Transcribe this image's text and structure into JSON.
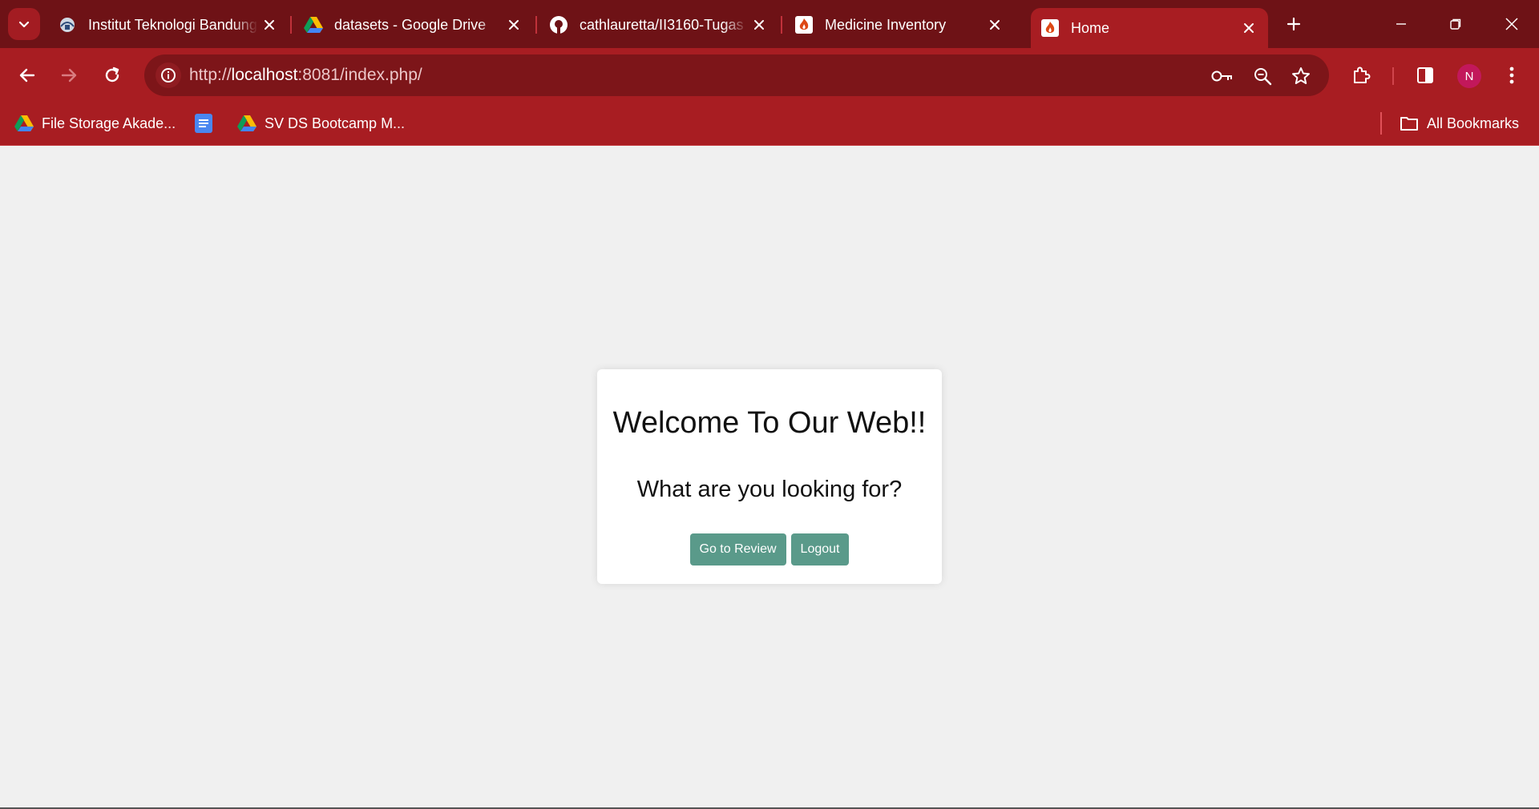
{
  "tabs": [
    {
      "title": "Institut Teknologi Bandung",
      "icon": "itb-logo-icon"
    },
    {
      "title": "datasets - Google Drive",
      "icon": "google-drive-icon"
    },
    {
      "title": "cathlauretta/II3160-Tugas",
      "icon": "github-icon"
    },
    {
      "title": "Medicine Inventory",
      "icon": "codeigniter-icon"
    },
    {
      "title": "Home",
      "icon": "codeigniter-icon",
      "active": true
    }
  ],
  "address_bar": {
    "scheme": "http://",
    "host": "localhost",
    "path": ":8081/index.php/"
  },
  "bookmarks": [
    {
      "label": "File Storage Akade...",
      "icon": "google-drive-icon"
    },
    {
      "label": "",
      "icon": "google-docs-icon"
    },
    {
      "label": "SV DS Bootcamp M...",
      "icon": "google-drive-icon"
    }
  ],
  "all_bookmarks_label": "All Bookmarks",
  "profile_initial": "N",
  "page": {
    "heading": "Welcome To Our Web!!",
    "subheading": "What are you looking for?",
    "review_button": "Go to Review",
    "logout_button": "Logout"
  },
  "colors": {
    "tabstrip": "#6e1216",
    "toolbar": "#a81d22",
    "omnibox": "#7d1519",
    "button": "#5a9a8a",
    "avatar": "#c2185b"
  }
}
